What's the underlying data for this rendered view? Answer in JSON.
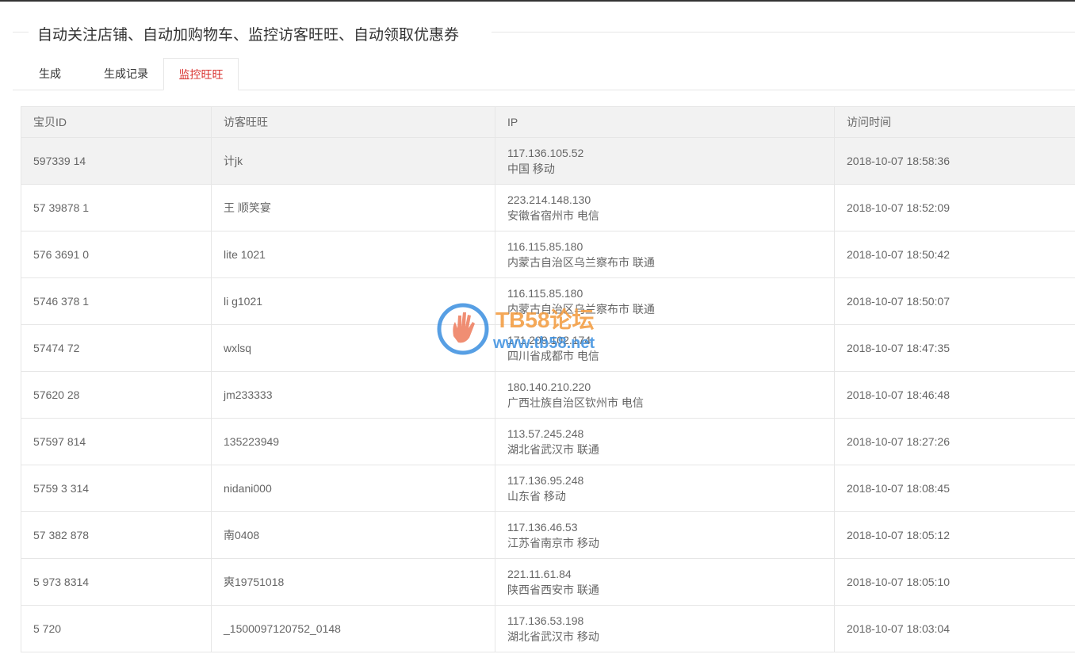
{
  "header": {
    "title": "自动关注店铺、自动加购物车、监控访客旺旺、自动领取优惠券"
  },
  "tabs": [
    {
      "label": "生成",
      "active": false
    },
    {
      "label": "生成记录",
      "active": false
    },
    {
      "label": "监控旺旺",
      "active": true
    }
  ],
  "colors": {
    "active_tab": "#d9302d",
    "header_bg": "#f2f2f2",
    "border": "#e6e6e6"
  },
  "table": {
    "columns": [
      "宝贝ID",
      "访客旺旺",
      "IP",
      "访问时间"
    ],
    "rows": [
      {
        "id": "597339 14",
        "wangwang": "计jk",
        "ip": "117.136.105.52",
        "location": "中国 移动",
        "time": "2018-10-07 18:58:36"
      },
      {
        "id": "57 39878 1",
        "wangwang": "王 顺笑宴",
        "ip": "223.214.148.130",
        "location": "安徽省宿州市 电信",
        "time": "2018-10-07 18:52:09"
      },
      {
        "id": "576 3691 0",
        "wangwang": "lite 1021",
        "ip": "116.115.85.180",
        "location": "内蒙古自治区乌兰察布市 联通",
        "time": "2018-10-07 18:50:42"
      },
      {
        "id": "5746 378 1",
        "wangwang": "li g1021",
        "ip": "116.115.85.180",
        "location": "内蒙古自治区乌兰察布市 联通",
        "time": "2018-10-07 18:50:07"
      },
      {
        "id": "57474 72",
        "wangwang": "wxlsq",
        "ip": "171.209.102.174",
        "location": "四川省成都市 电信",
        "time": "2018-10-07 18:47:35"
      },
      {
        "id": "57620 28",
        "wangwang": "jm233333",
        "ip": "180.140.210.220",
        "location": "广西壮族自治区钦州市 电信",
        "time": "2018-10-07 18:46:48"
      },
      {
        "id": "57597 814",
        "wangwang": "135223949",
        "ip": "113.57.245.248",
        "location": "湖北省武汉市 联通",
        "time": "2018-10-07 18:27:26"
      },
      {
        "id": "5759 3 314",
        "wangwang": "nidani000",
        "ip": "117.136.95.248",
        "location": "山东省 移动",
        "time": "2018-10-07 18:08:45"
      },
      {
        "id": "57 382 878",
        "wangwang": "南0408",
        "ip": "117.136.46.53",
        "location": "江苏省南京市 移动",
        "time": "2018-10-07 18:05:12"
      },
      {
        "id": "5 973 8314",
        "wangwang": "爽19751018",
        "ip": "221.11.61.84",
        "location": "陕西省西安市 联通",
        "time": "2018-10-07 18:05:10"
      },
      {
        "id": "5 720",
        "wangwang": "_1500097120752_0148",
        "ip": "117.136.53.198",
        "location": "湖北省武汉市 移动",
        "time": "2018-10-07 18:03:04"
      }
    ]
  },
  "watermark": {
    "title": "TB58论坛",
    "url": "www.tb58.net",
    "icon": "hand-logo-icon"
  }
}
